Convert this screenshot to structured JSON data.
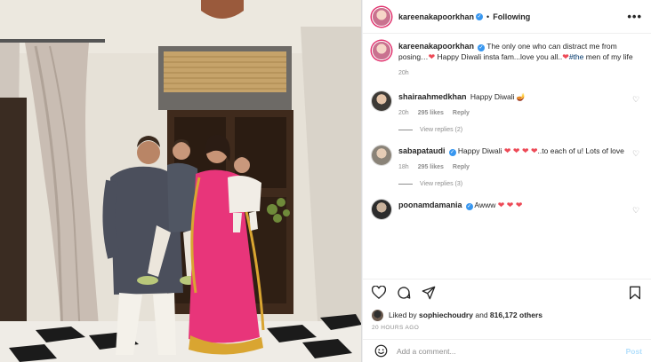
{
  "header": {
    "username": "kareenakapoorkhan",
    "separator": "•",
    "follow_state": "Following",
    "more_label": "•••"
  },
  "caption": {
    "username": "kareenakapoorkhan",
    "text_a": "The only one who can distract me from posing…",
    "text_b": "Happy Diwali insta fam...love you all..",
    "hashtag": "#the",
    "text_c": "men of my life",
    "age": "20h"
  },
  "comments": [
    {
      "username": "shairaahmedkhan",
      "text": "Happy Diwali",
      "emoji": "🪔",
      "age": "20h",
      "likes": "295 likes",
      "reply": "Reply",
      "view_replies": "View replies (2)",
      "verified": false
    },
    {
      "username": "sabapataudi",
      "text": "Happy Diwali",
      "hearts": "❤ ❤ ❤ ❤",
      "text_after": "..to each of u! Lots of love",
      "age": "18h",
      "likes": "295 likes",
      "reply": "Reply",
      "view_replies": "View replies (3)",
      "verified": true
    },
    {
      "username": "poonamdamania",
      "text": "Awww",
      "hearts": "❤ ❤ ❤",
      "verified": true
    }
  ],
  "likes": {
    "prefix": "Liked by",
    "user": "sophiechoudry",
    "mid": "and",
    "count": "816,172 others"
  },
  "timestamp": "20 HOURS AGO",
  "add_comment": {
    "placeholder": "Add a comment...",
    "post_label": "Post"
  },
  "icons": [
    "heart-icon",
    "comment-icon",
    "share-icon",
    "bookmark-icon",
    "emoji-icon",
    "verified-icon",
    "more-icon"
  ],
  "colors": {
    "link": "#00376b",
    "verified": "#3897f0",
    "heart": "#ed4956",
    "muted": "#8e8e8e",
    "post_disabled": "#b2dffc"
  }
}
